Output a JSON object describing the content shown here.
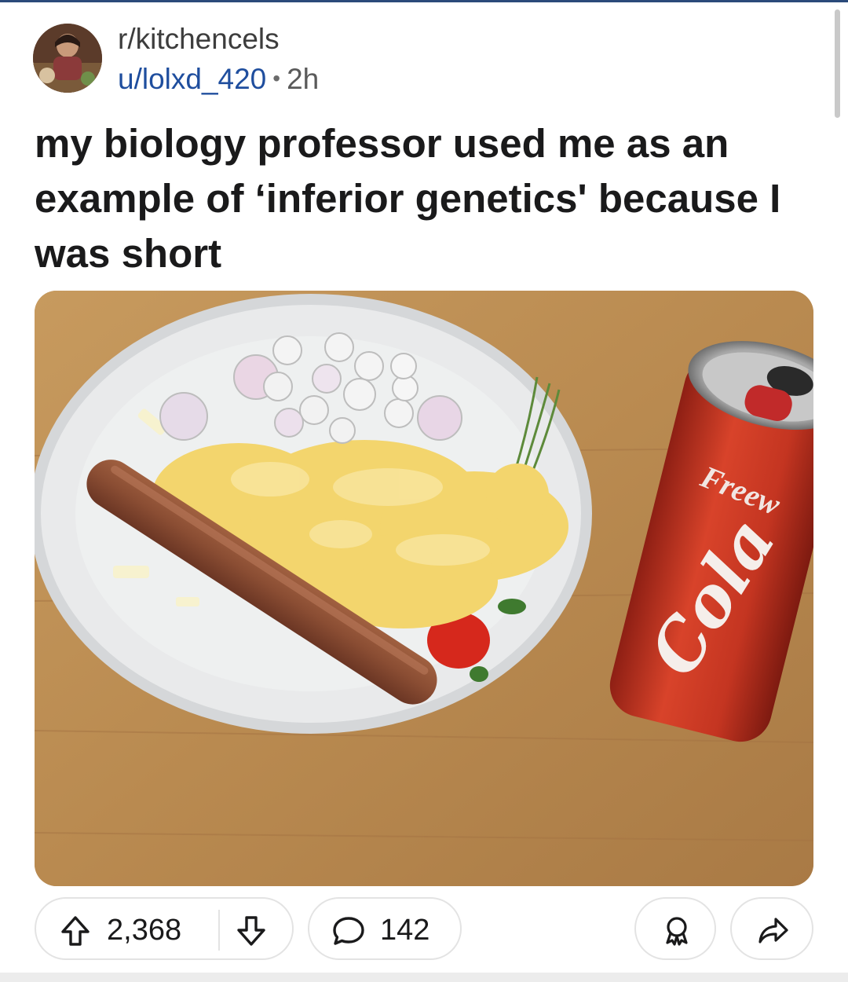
{
  "post": {
    "subreddit": "r/kitchencels",
    "author": "u/lolxd_420",
    "separator": "•",
    "age": "2h",
    "title": "my biology professor used me as an example of ‘inferior genetics' because I was short"
  },
  "image": {
    "can_brand": "Freew",
    "can_script": "Cola"
  },
  "actions": {
    "upvotes": "2,368",
    "comments": "142"
  },
  "icons": {
    "upvote": "upvote-arrow-icon",
    "downvote": "downvote-arrow-icon",
    "comment": "comment-bubble-icon",
    "award": "award-icon",
    "share": "share-arrow-icon"
  },
  "colors": {
    "author_link": "#1f4e9e",
    "can_red": "#c8321e",
    "border": "#e3e3e3"
  }
}
